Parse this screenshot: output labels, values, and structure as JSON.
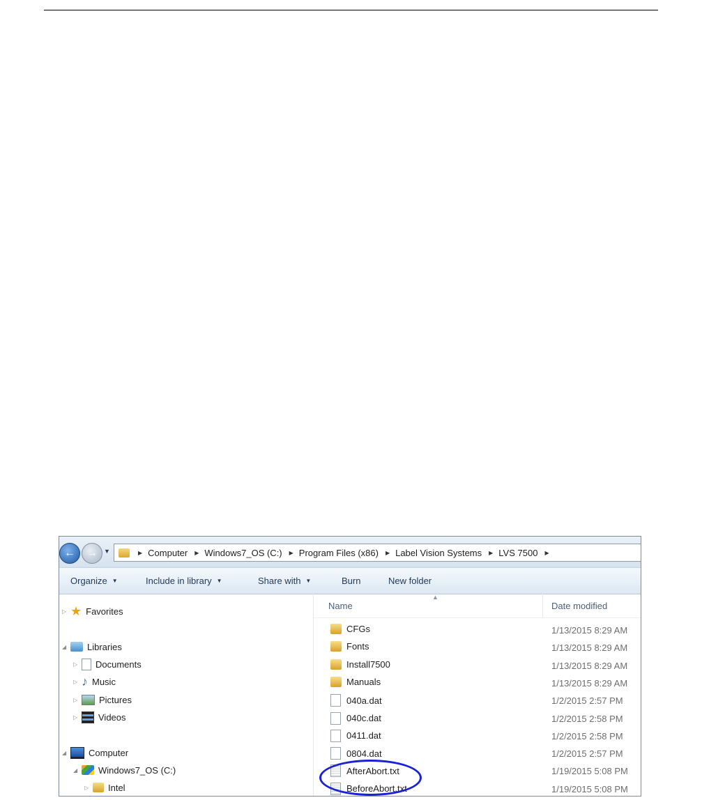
{
  "address": {
    "crumbs": [
      "Computer",
      "Windows7_OS (C:)",
      "Program Files (x86)",
      "Label Vision Systems",
      "LVS 7500"
    ]
  },
  "toolbar": {
    "organize": "Organize",
    "include_in_library": "Include in library",
    "share_with": "Share with",
    "burn": "Burn",
    "new_folder": "New folder"
  },
  "nav": {
    "favorites": "Favorites",
    "libraries": "Libraries",
    "documents": "Documents",
    "music": "Music",
    "pictures": "Pictures",
    "videos": "Videos",
    "computer": "Computer",
    "drive": "Windows7_OS (C:)",
    "intel": "Intel"
  },
  "columns": {
    "name": "Name",
    "date_modified": "Date modified"
  },
  "files": [
    {
      "name": "CFGs",
      "date": "1/13/2015 8:29 AM",
      "type": "folder"
    },
    {
      "name": "Fonts",
      "date": "1/13/2015 8:29 AM",
      "type": "folder"
    },
    {
      "name": "Install7500",
      "date": "1/13/2015 8:29 AM",
      "type": "folder"
    },
    {
      "name": "Manuals",
      "date": "1/13/2015 8:29 AM",
      "type": "folder"
    },
    {
      "name": "040a.dat",
      "date": "1/2/2015 2:57 PM",
      "type": "file"
    },
    {
      "name": "040c.dat",
      "date": "1/2/2015 2:58 PM",
      "type": "file"
    },
    {
      "name": "0411.dat",
      "date": "1/2/2015 2:58 PM",
      "type": "file"
    },
    {
      "name": "0804.dat",
      "date": "1/2/2015 2:57 PM",
      "type": "file"
    },
    {
      "name": "AfterAbort.txt",
      "date": "1/19/2015 5:08 PM",
      "type": "txt"
    },
    {
      "name": "BeforeAbort.txt",
      "date": "1/19/2015 5:08 PM",
      "type": "txt"
    }
  ],
  "colors": {
    "highlight": "#1a22d6",
    "toolbar_text": "#1e395b"
  }
}
